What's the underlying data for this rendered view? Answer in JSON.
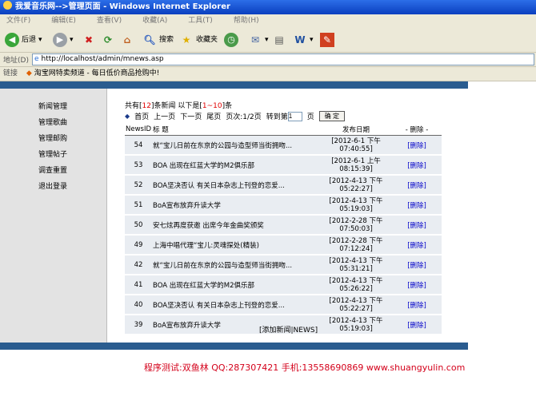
{
  "window": {
    "title": "我爱音乐网-->管理页面 - Windows Internet Explorer"
  },
  "menu": [
    "文件(F)",
    "编辑(E)",
    "查看(V)",
    "收藏(A)",
    "工具(T)",
    "帮助(H)"
  ],
  "toolbar": {
    "back_label": "后退",
    "search_label": "搜索",
    "favorites_label": "收藏夹"
  },
  "address": {
    "label": "地址(D)",
    "url": "http://localhost/admin/mnews.asp"
  },
  "links": {
    "label": "链接",
    "item": "淘宝网特卖频道 - 每日低价商品抢购中!"
  },
  "sidebar": {
    "items": [
      "新闻管理",
      "管理歌曲",
      "管理邮购",
      "管理帖子",
      "调查重置",
      "退出登录"
    ]
  },
  "summary": {
    "prefix": "共有[",
    "total": "12",
    "mid": "]条新闻 以下是[",
    "range": "1~10",
    "suffix": "]条"
  },
  "pager": {
    "first": "首页",
    "prev": "上一页",
    "next": "下一页",
    "last": "尾页",
    "pageinfo": "页次:1/2页",
    "goto": "转到第",
    "page_value": "1",
    "page_unit": "页",
    "confirm": "确 定"
  },
  "table": {
    "headers": {
      "id": "NewsID",
      "title": "标 题",
      "date": "发布日期",
      "delete": "- 删除 -"
    },
    "rows": [
      {
        "id": "54",
        "title": "就“宝儿日前在东京的公园与造型师当街拥吻...",
        "date1": "[2012-6-1 下午",
        "date2": "07:40:55]",
        "del": "[删除]"
      },
      {
        "id": "53",
        "title": "BOA 出现在红蓝大学的M2俱乐部",
        "date1": "[2012-6-1 上午",
        "date2": "08:15:39]",
        "del": "[删除]"
      },
      {
        "id": "52",
        "title": "BOA坚决否认 有关日本杂志上刊登的恋爱...",
        "date1": "[2012-4-13 下午",
        "date2": "05:22:27]",
        "del": "[删除]"
      },
      {
        "id": "51",
        "title": "BoA宣布放弃升读大学",
        "date1": "[2012-4-13 下午",
        "date2": "05:19:03]",
        "del": "[删除]"
      },
      {
        "id": "50",
        "title": "安七炫再度获邀 出席今年金曲奖颁奖",
        "date1": "[2012-2-28 下午",
        "date2": "07:50:03]",
        "del": "[删除]"
      },
      {
        "id": "49",
        "title": "上海中唱代理“宝儿:灵魂探处(精装)",
        "date1": "[2012-2-28 下午",
        "date2": "07:12:24]",
        "del": "[删除]"
      },
      {
        "id": "42",
        "title": "就“宝儿日前在东京的公园与造型师当街拥吻...",
        "date1": "[2012-4-13 下午",
        "date2": "05:31:21]",
        "del": "[删除]"
      },
      {
        "id": "41",
        "title": "BOA 出现在红蓝大学的M2俱乐部",
        "date1": "[2012-4-13 下午",
        "date2": "05:26:22]",
        "del": "[删除]"
      },
      {
        "id": "40",
        "title": "BOA坚决否认 有关日本杂志上刊登的恋爱...",
        "date1": "[2012-4-13 下午",
        "date2": "05:22:27]",
        "del": "[删除]"
      },
      {
        "id": "39",
        "title": "BoA宣布放弃升读大学",
        "date1": "[2012-4-13 下午",
        "date2": "05:19:03]",
        "del": "[删除]"
      }
    ]
  },
  "add_link": "[添加新闻|NEWS]",
  "footer": "程序测试:双鱼林 QQ:287307421 手机:13558690869 www.shuangyulin.com"
}
